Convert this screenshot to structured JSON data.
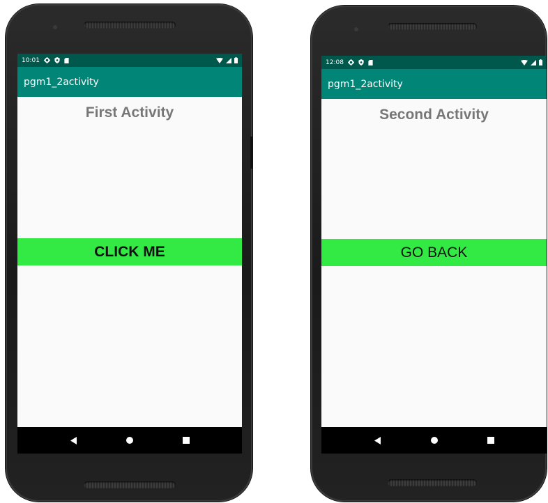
{
  "colors": {
    "status_bar": "#00574b",
    "app_bar": "#008577",
    "button": "#33ea45",
    "title_text": "#777777"
  },
  "screens": [
    {
      "status_time": "10:01",
      "status_icons": [
        "gear-icon",
        "shield-icon",
        "sd-card-icon"
      ],
      "system_icons": [
        "wifi-icon",
        "signal-icon",
        "battery-icon"
      ],
      "app_title": "pgm1_2activity",
      "activity_title": "First Activity",
      "button_label": "CLICK ME"
    },
    {
      "status_time": "12:08",
      "status_icons": [
        "gear-icon",
        "shield-icon",
        "sd-card-icon"
      ],
      "system_icons": [
        "wifi-icon",
        "signal-icon",
        "battery-icon"
      ],
      "app_title": "pgm1_2activity",
      "activity_title": "Second Activity",
      "button_label": "GO BACK"
    }
  ],
  "nav_icons": [
    "back-icon",
    "home-icon",
    "recents-icon"
  ]
}
